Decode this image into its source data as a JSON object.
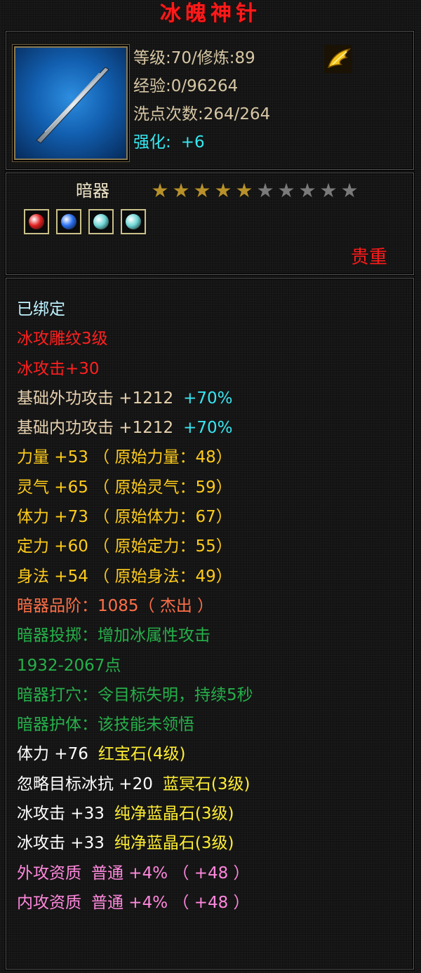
{
  "item": {
    "name": "冰魄神针",
    "level_line": "等级:70/修炼:89",
    "exp_line": "经验:0/96264",
    "reset_line": "洗点次数:264/264",
    "enhance_label": "强化:",
    "enhance_value": "+6",
    "category": "暗器",
    "stars_total": 10,
    "stars_filled": 5,
    "rarity": "贵重",
    "icon": "silver-needle-icon",
    "badge_icon": "golden-wing-icon"
  },
  "gems": [
    {
      "name": "红宝石",
      "icon": "red-gem-icon",
      "color": "#e02020"
    },
    {
      "name": "蓝冥石",
      "icon": "blue-gem-icon",
      "color": "#2a6ff0"
    },
    {
      "name": "纯净蓝晶石",
      "icon": "crystal-gem-icon",
      "color": "#6fd6d6"
    },
    {
      "name": "纯净蓝晶石",
      "icon": "crystal-gem-icon",
      "color": "#6fd6d6"
    }
  ],
  "attributes": [
    {
      "parts": [
        {
          "text": "已绑定",
          "color": "bound"
        }
      ]
    },
    {
      "parts": [
        {
          "text": "冰攻雕纹3级",
          "color": "red"
        }
      ]
    },
    {
      "parts": [
        {
          "text": "冰攻击+30",
          "color": "red"
        }
      ]
    },
    {
      "parts": [
        {
          "text": "基础外功攻击 +1212",
          "color": "tan"
        },
        {
          "text": "+70%",
          "color": "cyan"
        }
      ]
    },
    {
      "parts": [
        {
          "text": "基础内功攻击 +1212",
          "color": "tan"
        },
        {
          "text": "+70%",
          "color": "cyan"
        }
      ]
    },
    {
      "parts": [
        {
          "text": "力量 +53 （ 原始力量：48）",
          "color": "yellow"
        }
      ]
    },
    {
      "parts": [
        {
          "text": "灵气 +65 （ 原始灵气：59）",
          "color": "yellow"
        }
      ]
    },
    {
      "parts": [
        {
          "text": "体力 +73 （ 原始体力：67）",
          "color": "yellow"
        }
      ]
    },
    {
      "parts": [
        {
          "text": "定力 +60 （ 原始定力：55）",
          "color": "yellow"
        }
      ]
    },
    {
      "parts": [
        {
          "text": "身法 +54 （ 原始身法：49）",
          "color": "yellow"
        }
      ]
    },
    {
      "parts": [
        {
          "text": "暗器品阶：1085（ 杰出 ）",
          "color": "orange"
        }
      ]
    },
    {
      "parts": [
        {
          "text": "暗器投掷：增加冰属性攻击",
          "color": "green"
        }
      ]
    },
    {
      "parts": [
        {
          "text": "1932-2067点",
          "color": "green"
        }
      ]
    },
    {
      "parts": [
        {
          "text": "暗器打穴：令目标失明，持续5秒",
          "color": "green"
        }
      ]
    },
    {
      "parts": [
        {
          "text": "暗器护体：该技能未领悟",
          "color": "green"
        }
      ]
    },
    {
      "parts": [
        {
          "text": "体力 +76",
          "color": "gemtxt"
        },
        {
          "text": "红宝石(4级)",
          "color": "gemname"
        }
      ]
    },
    {
      "parts": [
        {
          "text": "忽略目标冰抗 +20",
          "color": "gemtxt"
        },
        {
          "text": "蓝冥石(3级)",
          "color": "gemname"
        }
      ]
    },
    {
      "parts": [
        {
          "text": "冰攻击 +33",
          "color": "gemtxt"
        },
        {
          "text": "纯净蓝晶石(3级)",
          "color": "gemname"
        }
      ]
    },
    {
      "parts": [
        {
          "text": "冰攻击 +33",
          "color": "gemtxt"
        },
        {
          "text": "纯净蓝晶石(3级)",
          "color": "gemname"
        }
      ]
    },
    {
      "parts": [
        {
          "text": "外攻资质",
          "color": "pink"
        },
        {
          "text": "普通 +4% （ +48 ）",
          "color": "pink"
        }
      ]
    },
    {
      "parts": [
        {
          "text": "内攻资质",
          "color": "pink"
        },
        {
          "text": "普通 +4% （ +48 ）",
          "color": "pink"
        }
      ]
    }
  ]
}
